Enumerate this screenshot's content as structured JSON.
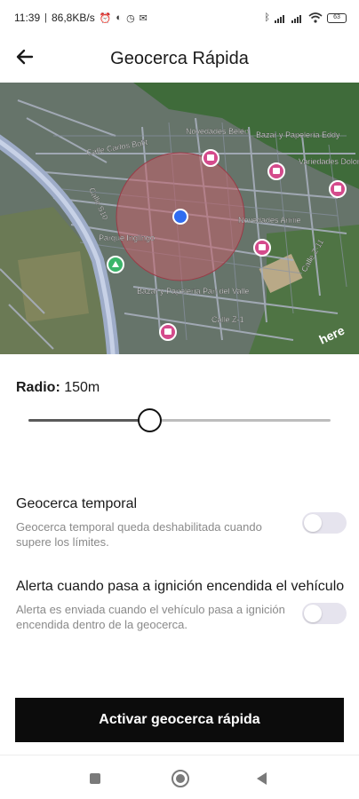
{
  "status_bar": {
    "time": "11:39",
    "speed": "86,8KB/s",
    "battery": "63"
  },
  "header": {
    "title": "Geocerca Rápida"
  },
  "map": {
    "labels": [
      "Novedades Belén",
      "Bazar y Papelería Eddy",
      "Calle Carlos Bolít",
      "Variedades Dolores",
      "Novedades Annie",
      "Parque Inglingo",
      "Calle S10",
      "Bazar y Papelería Pan del Valle",
      "Calle Z-1",
      "Calle Z-11"
    ],
    "logo": "here"
  },
  "radius": {
    "label": "Radio:",
    "value": "150m",
    "level": 0.4
  },
  "settings": [
    {
      "title": "Geocerca temporal",
      "description": "Geocerca temporal queda deshabilitada cuando supere los límites.",
      "enabled": false
    },
    {
      "title": "Alerta cuando pasa a ignición encendida el vehículo",
      "description": "Alerta es enviada cuando el vehículo pasa a ignición encendida dentro de la geocerca.",
      "enabled": false
    }
  ],
  "cta": {
    "label": "Activar geocerca rápida"
  },
  "colors": {
    "geofence": "#c2606a",
    "location_dot": "#2f6cf0",
    "poi": "#d44b8c",
    "button": "#0c0c0c",
    "toggle_off": "#e6e4ee"
  }
}
